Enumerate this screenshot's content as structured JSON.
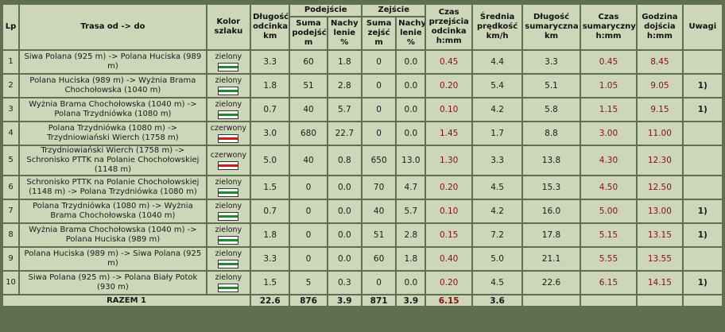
{
  "headers": {
    "lp": "Lp",
    "trasa": "Trasa od -> do",
    "kolor": "Kolor szlaku",
    "dlugosc": "Długość odcinka km",
    "podejscie": "Podejście",
    "suma_podejsc": "Suma podejść m",
    "nachylenie_p": "Nachy lenie %",
    "zejscie": "Zejście",
    "suma_zejsc": "Suma zejść m",
    "nachylenie_z": "Nachy lenie %",
    "czas": "Czas przejścia odcinka h:mm",
    "predkosc": "Średnia prędkość km/h",
    "dlugosc_sum": "Długość sumaryczna km",
    "czas_sum": "Czas sumaryczny h:mm",
    "godzina": "Godzina dojścia h:mm",
    "uwagi": "Uwagi"
  },
  "trail_colors": {
    "zielony": "#1e8a2e",
    "czerwony": "#d01818"
  },
  "rows": [
    {
      "lp": "1",
      "trasa": "Siwa Polana (925 m) -> Polana Huciska (989 m)",
      "kolor": "zielony",
      "dlugosc": "3.3",
      "suma_podejsc": "60",
      "nachylenie_p": "1.8",
      "suma_zejsc": "0",
      "nachylenie_z": "0.0",
      "czas": "0.45",
      "predkosc": "4.4",
      "dlugosc_sum": "3.3",
      "czas_sum": "0.45",
      "godzina": "8.45",
      "uwagi": ""
    },
    {
      "lp": "2",
      "trasa": "Polana Huciska (989 m) -> Wyżnia Brama Chochołowska (1040 m)",
      "kolor": "zielony",
      "dlugosc": "1.8",
      "suma_podejsc": "51",
      "nachylenie_p": "2.8",
      "suma_zejsc": "0",
      "nachylenie_z": "0.0",
      "czas": "0.20",
      "predkosc": "5.4",
      "dlugosc_sum": "5.1",
      "czas_sum": "1.05",
      "godzina": "9.05",
      "uwagi": "1)"
    },
    {
      "lp": "3",
      "trasa": "Wyżnia Brama Chochołowska (1040 m) -> Polana Trzydniówka (1080 m)",
      "kolor": "zielony",
      "dlugosc": "0.7",
      "suma_podejsc": "40",
      "nachylenie_p": "5.7",
      "suma_zejsc": "0",
      "nachylenie_z": "0.0",
      "czas": "0.10",
      "predkosc": "4.2",
      "dlugosc_sum": "5.8",
      "czas_sum": "1.15",
      "godzina": "9.15",
      "uwagi": "1)"
    },
    {
      "lp": "4",
      "trasa": "Polana Trzydniówka (1080 m) -> Trzydniowiański Wierch (1758 m)",
      "kolor": "czerwony",
      "dlugosc": "3.0",
      "suma_podejsc": "680",
      "nachylenie_p": "22.7",
      "suma_zejsc": "0",
      "nachylenie_z": "0.0",
      "czas": "1.45",
      "predkosc": "1.7",
      "dlugosc_sum": "8.8",
      "czas_sum": "3.00",
      "godzina": "11.00",
      "uwagi": ""
    },
    {
      "lp": "5",
      "trasa": "Trzydniowiański Wierch (1758 m) -> Schronisko PTTK na Polanie Chochołowskiej (1148 m)",
      "kolor": "czerwony",
      "dlugosc": "5.0",
      "suma_podejsc": "40",
      "nachylenie_p": "0.8",
      "suma_zejsc": "650",
      "nachylenie_z": "13.0",
      "czas": "1.30",
      "predkosc": "3.3",
      "dlugosc_sum": "13.8",
      "czas_sum": "4.30",
      "godzina": "12.30",
      "uwagi": ""
    },
    {
      "lp": "6",
      "trasa": "Schronisko PTTK na Polanie Chochołowskiej (1148 m) -> Polana Trzydniówka (1080 m)",
      "kolor": "zielony",
      "dlugosc": "1.5",
      "suma_podejsc": "0",
      "nachylenie_p": "0.0",
      "suma_zejsc": "70",
      "nachylenie_z": "4.7",
      "czas": "0.20",
      "predkosc": "4.5",
      "dlugosc_sum": "15.3",
      "czas_sum": "4.50",
      "godzina": "12.50",
      "uwagi": ""
    },
    {
      "lp": "7",
      "trasa": "Polana Trzydniówka (1080 m) -> Wyżnia Brama Chochołowska (1040 m)",
      "kolor": "zielony",
      "dlugosc": "0.7",
      "suma_podejsc": "0",
      "nachylenie_p": "0.0",
      "suma_zejsc": "40",
      "nachylenie_z": "5.7",
      "czas": "0.10",
      "predkosc": "4.2",
      "dlugosc_sum": "16.0",
      "czas_sum": "5.00",
      "godzina": "13.00",
      "uwagi": "1)"
    },
    {
      "lp": "8",
      "trasa": "Wyżnia Brama Chochołowska (1040 m) -> Polana Huciska (989 m)",
      "kolor": "zielony",
      "dlugosc": "1.8",
      "suma_podejsc": "0",
      "nachylenie_p": "0.0",
      "suma_zejsc": "51",
      "nachylenie_z": "2.8",
      "czas": "0.15",
      "predkosc": "7.2",
      "dlugosc_sum": "17.8",
      "czas_sum": "5.15",
      "godzina": "13.15",
      "uwagi": "1)"
    },
    {
      "lp": "9",
      "trasa": "Polana Huciska (989 m) -> Siwa Polana (925 m)",
      "kolor": "zielony",
      "dlugosc": "3.3",
      "suma_podejsc": "0",
      "nachylenie_p": "0.0",
      "suma_zejsc": "60",
      "nachylenie_z": "1.8",
      "czas": "0.40",
      "predkosc": "5.0",
      "dlugosc_sum": "21.1",
      "czas_sum": "5.55",
      "godzina": "13.55",
      "uwagi": ""
    },
    {
      "lp": "10",
      "trasa": "Siwa Polana (925 m) -> Polana Biały Potok (930 m)",
      "kolor": "zielony",
      "dlugosc": "1.5",
      "suma_podejsc": "5",
      "nachylenie_p": "0.3",
      "suma_zejsc": "0",
      "nachylenie_z": "0.0",
      "czas": "0.20",
      "predkosc": "4.5",
      "dlugosc_sum": "22.6",
      "czas_sum": "6.15",
      "godzina": "14.15",
      "uwagi": "1)"
    }
  ],
  "total": {
    "label": "RAZEM 1",
    "dlugosc": "22.6",
    "suma_podejsc": "876",
    "nachylenie_p": "3.9",
    "suma_zejsc": "871",
    "nachylenie_z": "3.9",
    "czas": "6.15",
    "predkosc": "3.6"
  }
}
